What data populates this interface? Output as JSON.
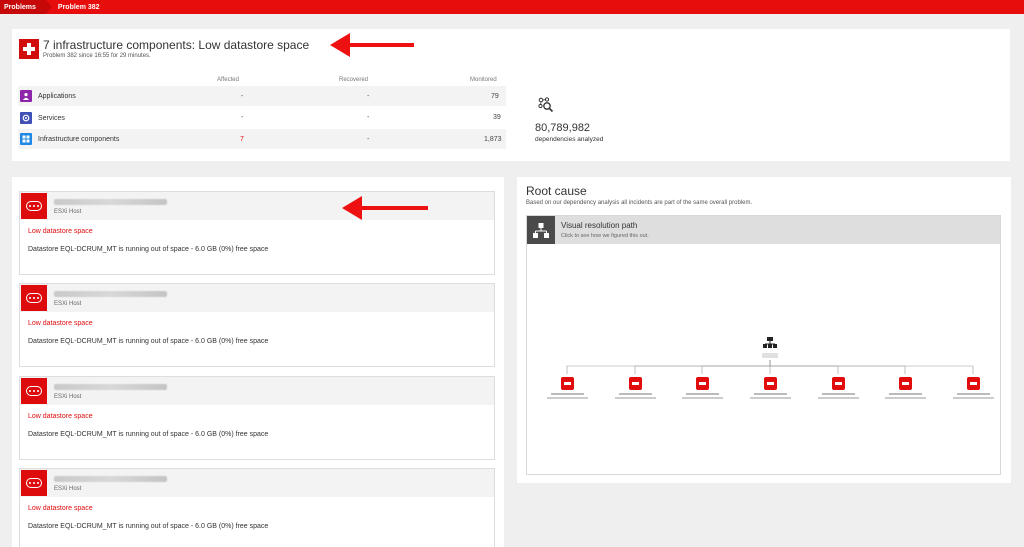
{
  "breadcrumb": {
    "problems": "Problems",
    "current": "Problem 382"
  },
  "problem": {
    "title": "7 infrastructure components: Low datastore space",
    "subtitle": "Problem 382 since 16:55 for 29 minutes."
  },
  "impact_table": {
    "headers": {
      "affected": "Affected",
      "recovered": "Recovered",
      "monitored": "Monitored"
    },
    "rows": [
      {
        "label": "Applications",
        "icon": "applications-icon",
        "affected": "-",
        "recovered": "-",
        "monitored": "79"
      },
      {
        "label": "Services",
        "icon": "services-icon",
        "affected": "-",
        "recovered": "-",
        "monitored": "39"
      },
      {
        "label": "Infrastructure components",
        "icon": "infrastructure-icon",
        "affected": "7",
        "recovered": "-",
        "monitored": "1,873"
      }
    ]
  },
  "dependencies": {
    "count": "80,789,982",
    "label": "dependencies analyzed"
  },
  "events": [
    {
      "type": "ESXi Host",
      "issue": "Low datastore space",
      "description": "Datastore EQL-DCRUM_MT is running out of space - 6.0 GB (0%) free space"
    },
    {
      "type": "ESXi Host",
      "issue": "Low datastore space",
      "description": "Datastore EQL-DCRUM_MT is running out of space - 6.0 GB (0%) free space"
    },
    {
      "type": "ESXi Host",
      "issue": "Low datastore space",
      "description": "Datastore EQL-DCRUM_MT is running out of space - 6.0 GB (0%) free space"
    },
    {
      "type": "ESXi Host",
      "issue": "Low datastore space",
      "description": "Datastore EQL-DCRUM_MT is running out of space - 6.0 GB (0%) free space"
    }
  ],
  "root_cause": {
    "title": "Root cause",
    "subtitle": "Based on our dependency analysis all incidents are part of the same overall problem.",
    "visual_path": {
      "title": "Visual resolution path",
      "subtitle": "Click to see how we figured this out."
    }
  },
  "colors": {
    "brand_red": "#e80d0d",
    "problem_red": "#d10c0c",
    "app_purple": "#8e24aa",
    "service_blue": "#3f51b5",
    "infra_blue": "#1e88e5"
  }
}
